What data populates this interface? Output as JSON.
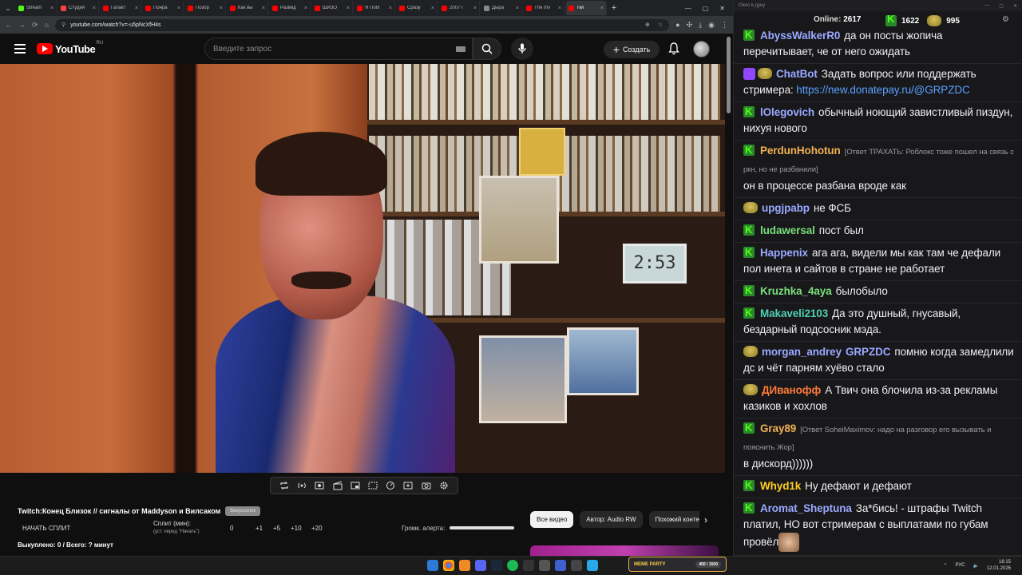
{
  "browser": {
    "tabs": [
      {
        "label": "Stream",
        "color": "#53fc18"
      },
      {
        "label": "Студия",
        "color": "#ff4040"
      },
      {
        "label": "Галакт",
        "color": "#ff0000"
      },
      {
        "label": "Понра",
        "color": "#ff0000"
      },
      {
        "label": "Позор",
        "color": "#ff0000"
      },
      {
        "label": "Как вы",
        "color": "#ff0000"
      },
      {
        "label": "Развед",
        "color": "#ff0000"
      },
      {
        "label": "ШИЗО",
        "color": "#ff0000"
      },
      {
        "label": "Я Побі",
        "color": "#ff0000"
      },
      {
        "label": "Сразу",
        "color": "#ff0000"
      },
      {
        "label": "2007 Г",
        "color": "#ff0000"
      },
      {
        "label": "Дыра",
        "color": "#888888"
      },
      {
        "label": "The Inv",
        "color": "#ff0000"
      },
      {
        "label": "Twi",
        "color": "#ff0000"
      }
    ],
    "url": "youtube.com/watch?v=-u5pNcXfH4s"
  },
  "youtube": {
    "logo_text": "YouTube",
    "region": "RU",
    "search_placeholder": "Введите запрос",
    "create_label": "Создать"
  },
  "panel": {
    "title": "Twitch:Конец Близок // сигналы от Maddyson и Вилсаком",
    "badge": "Вверхсклок",
    "start_split": "НАЧАТЬ СПЛИТ",
    "split_label": "Сплит (мин):",
    "split_hint": "(уст. перед \"Начать\")",
    "split_value": "0",
    "steps": [
      "+1",
      "+5",
      "+10",
      "+20"
    ],
    "alert_label": "Громк. алерта:",
    "summary": "Выкуплено: 0 / Всего: ? минут"
  },
  "chips": [
    "Все видео",
    "Автор: Audio RW",
    "Похожий контент"
  ],
  "chat": {
    "window_title": "Окно в дуну",
    "online_label": "Online:",
    "online": "2617",
    "k_count": "1622",
    "frog_count": "995",
    "messages": [
      {
        "badge": "k",
        "name": "AbyssWalkerR0",
        "color": "#9aa8ff",
        "text": "да он посты жопича перечитывает, че от него ожидать"
      },
      {
        "badge": "bot",
        "name": "ChatBot",
        "color": "#9aa8ff",
        "text": "Задать вопрос или поддержать стримера: ",
        "link": "https://new.donatepay.ru/@GRPZDC"
      },
      {
        "badge": "k",
        "name": "lOlegovich",
        "color": "#9aa8ff",
        "text": "обычный ноющий завистливый пиздун, нихуя нового"
      },
      {
        "badge": "k",
        "name": "PerdunHohotun",
        "color": "#f0b050",
        "reply": "[Ответ ТРАХАТЬ: Роблокс тоже пошел на связь с ркн, но не разбанили]",
        "text": "он в процессе разбана вроде как"
      },
      {
        "badge": "frog",
        "name": "upgjpabp",
        "color": "#9aa8ff",
        "text": "не ФСБ"
      },
      {
        "badge": "k",
        "name": "ludawersal",
        "color": "#7adf7a",
        "text": "пост был"
      },
      {
        "badge": "k",
        "name": "Happenix",
        "color": "#9aa8ff",
        "text": "ага ага, видели мы как там че дефали пол инета и сайтов в стране не работает"
      },
      {
        "badge": "k",
        "name": "Kruzhka_4aya",
        "color": "#7adf7a",
        "text": "былобыло"
      },
      {
        "badge": "k",
        "name": "Makaveli2103",
        "color": "#4fd0b0",
        "text": "Да это душный, гнусавый, бездарный подсосник мэда."
      },
      {
        "badge": "frog",
        "name": "morgan_andrey",
        "color": "#9aa8ff",
        "mention": "GRPZDC",
        "text": "помню когда замедлили дс и чёт парням хуёво стало"
      },
      {
        "badge": "frog",
        "name": "ДИванофф",
        "color": "#ff7a3a",
        "text": "А Твич она блочила из-за рекламы казиков и хохлов"
      },
      {
        "badge": "k",
        "name": "Gray89",
        "color": "#f0b050",
        "reply": "[Ответ SoheiMaximov: надо на разговор его вызывать и пояснить Жор]",
        "text": "в дискорд))))))"
      },
      {
        "badge": "k",
        "name": "Whyd1k",
        "color": "#ffcf20",
        "text": "Ну дефают и дефают"
      },
      {
        "badge": "k",
        "name": "Aromat_Sheptuna",
        "color": "#9aa8ff",
        "text": "За*бись! - штрафы Twitch платил, НО вот стримерам с выплатами по губам провёл"
      }
    ]
  },
  "taskbar": {
    "party_label": "MEME PARTY",
    "party_count": "450 / 1500",
    "lang": "РУС",
    "time": "18:15",
    "date": "12.01.2026"
  }
}
